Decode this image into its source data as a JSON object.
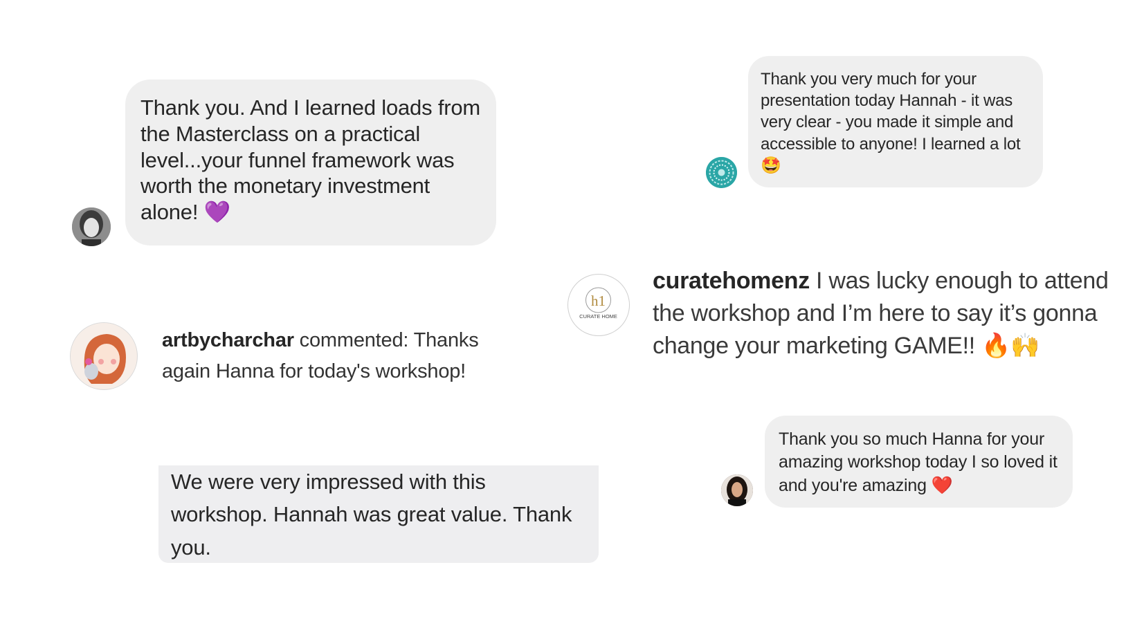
{
  "testimonials": {
    "t1": {
      "text": "Thank you. And I learned loads from the Masterclass on a practical level...your funnel framework was worth the monetary investment alone!",
      "emoji": "💜"
    },
    "t2": {
      "text": "Thank you very much for your presentation today Hannah - it was very clear - you made it simple and accessible to anyone! I learned a lot",
      "emoji": "🤩"
    },
    "t3": {
      "username": "curatehomenz",
      "text": " I was lucky enough to attend the workshop and I’m here to say it’s gonna change your marketing GAME!! ",
      "emoji1": "🔥",
      "emoji2": "🙌",
      "avatar_label": "CURATE HOME",
      "avatar_mark": "h1"
    },
    "t4": {
      "username": "artbycharchar",
      "text": " commented: Thanks again Hanna for today's workshop!"
    },
    "t5": {
      "text": "We were very impressed with this workshop. Hannah was great value. Thank you."
    },
    "t6": {
      "text": "Thank you so much Hanna for your amazing workshop today I so loved it and you're amazing ",
      "emoji": "❤️"
    }
  },
  "colors": {
    "bubble": "#efefef",
    "text": "#262626",
    "accent_teal": "#2aa6a6"
  }
}
